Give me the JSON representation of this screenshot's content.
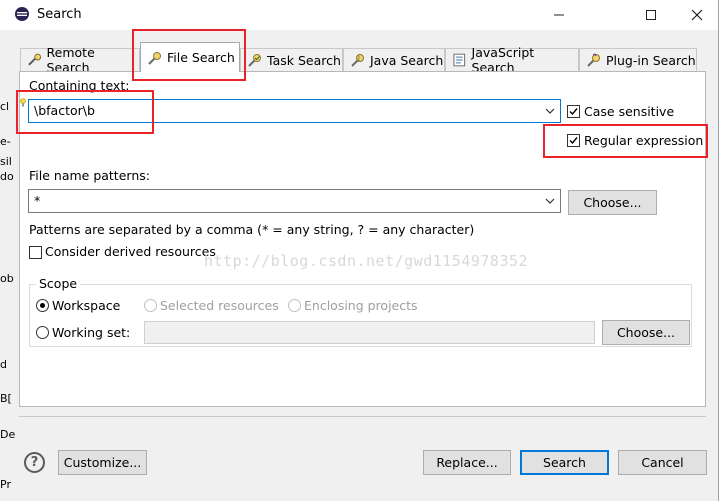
{
  "window": {
    "title": "Search"
  },
  "tabs": [
    {
      "label": "Remote Search"
    },
    {
      "label": "File Search"
    },
    {
      "label": "Task Search"
    },
    {
      "label": "Java Search"
    },
    {
      "label": "JavaScript Search"
    },
    {
      "label": "Plug-in Search"
    }
  ],
  "containing": {
    "label": "Containing text:",
    "value": "\\bfactor\\b",
    "case_sensitive_label": "Case sensitive",
    "regex_label": "Regular expression"
  },
  "file_patterns": {
    "label": "File name patterns:",
    "value": "*",
    "choose_label": "Choose...",
    "hint": "Patterns are separated by a comma (* = any string, ? = any character)",
    "derived_label": "Consider derived resources"
  },
  "watermark": "http://blog.csdn.net/gwd1154978352",
  "scope": {
    "label": "Scope",
    "workspace_label": "Workspace",
    "selected_label": "Selected resources",
    "enclosing_label": "Enclosing projects",
    "working_set_label": "Working set:",
    "choose_label": "Choose..."
  },
  "buttons": {
    "customize": "Customize...",
    "replace": "Replace...",
    "search": "Search",
    "cancel": "Cancel"
  },
  "background_fragments": [
    "e-",
    "cl",
    "sil",
    "do",
    "ob",
    "d",
    "B[",
    "De",
    "Pr"
  ],
  "colors": {
    "highlight": "#e8242a",
    "default_button_border": "#0078d7"
  }
}
